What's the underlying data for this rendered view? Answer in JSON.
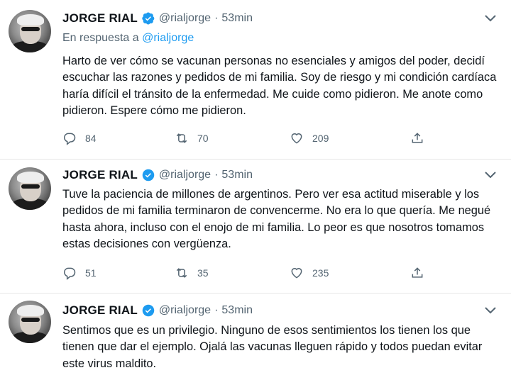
{
  "colors": {
    "accent": "#1d9bf0",
    "secondary_text": "#536471",
    "primary_text": "#0f1419"
  },
  "tweets": [
    {
      "name": "JORGE RIAL",
      "handle": "@rialjorge",
      "separator": "·",
      "time": "53min",
      "replying_prefix": "En respuesta a",
      "replying_to": "@rialjorge",
      "text": "Harto de ver cómo se vacunan personas no esenciales y amigos del poder, decidí escuchar las razones y pedidos de mi familia. Soy de riesgo y mi condición cardíaca haría difícil el tránsito de la enfermedad. Me cuide como pidieron. Me anote como pidieron. Espere cómo me pidieron.",
      "replies": "84",
      "retweets": "70",
      "likes": "209"
    },
    {
      "name": "JORGE RIAL",
      "handle": "@rialjorge",
      "separator": "·",
      "time": "53min",
      "text": "Tuve la paciencia de millones de argentinos. Pero ver esa actitud miserable y los pedidos de mi familia terminaron de convencerme. No era lo que quería. Me negué hasta ahora, incluso con el enojo de mi familia. Lo peor es que nosotros tomamos estas decisiones con vergüenza.",
      "replies": "51",
      "retweets": "35",
      "likes": "235"
    },
    {
      "name": "JORGE RIAL",
      "handle": "@rialjorge",
      "separator": "·",
      "time": "53min",
      "text": "Sentimos que es un privilegio. Ninguno de esos sentimientos los tienen los que tienen que dar el ejemplo. Ojalá las vacunas lleguen rápido y todos puedan evitar este virus maldito."
    }
  ]
}
